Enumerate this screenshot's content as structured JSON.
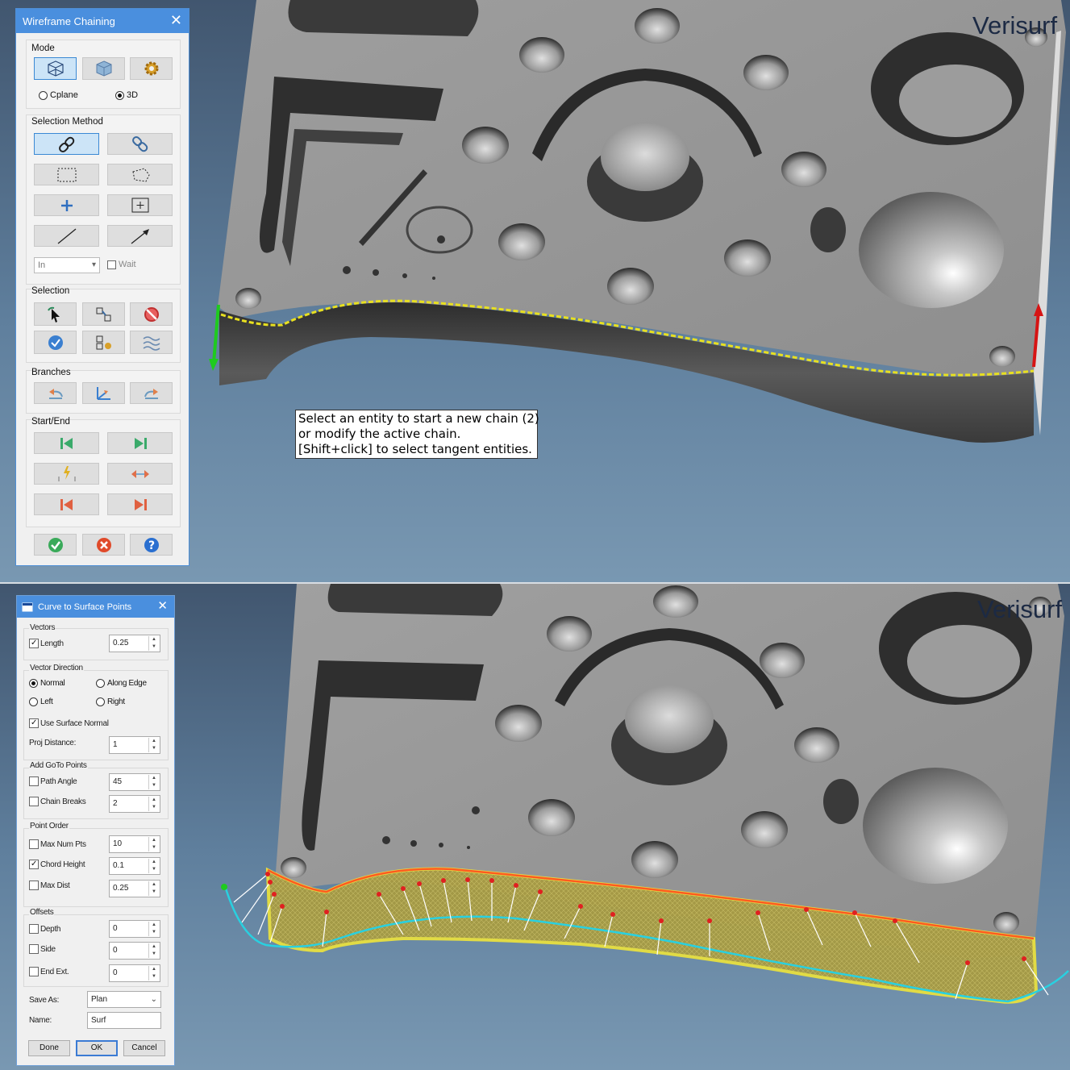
{
  "brand": "Verisurf",
  "top_panel": {
    "dialog": {
      "title": "Wireframe Chaining",
      "mode": {
        "label": "Mode",
        "buttons": [
          "wireframe-cube-icon",
          "solid-cube-icon",
          "gear-icon"
        ],
        "radio_cplane": "Cplane",
        "radio_3d": "3D",
        "selected": "3D"
      },
      "selection_method": {
        "label": "Selection Method",
        "buttons": [
          "chain-icon",
          "partial-chain-icon",
          "window-icon",
          "polygon-icon",
          "single-point-icon",
          "area-icon",
          "vector-line-icon",
          "vector-arrow-icon"
        ],
        "combo_value": "In",
        "wait_label": "Wait"
      },
      "selection": {
        "label": "Selection",
        "buttons": [
          "select-arrow-icon",
          "last-chain-icon",
          "unselect-icon",
          "select-all-icon",
          "chain-options-icon",
          "similar-icon"
        ]
      },
      "branches": {
        "label": "Branches",
        "buttons": [
          "branch-back-icon",
          "branch-axis-icon",
          "branch-forward-icon"
        ]
      },
      "start_end": {
        "label": "Start/End",
        "buttons": [
          "start-first-icon",
          "end-last-icon",
          "dynamic-icon",
          "reverse-icon",
          "move-start-icon",
          "move-end-icon"
        ]
      },
      "footer": [
        "ok-check-icon",
        "cancel-x-icon",
        "help-icon"
      ]
    },
    "tooltip": [
      "Select an entity to start a new chain (2)",
      "or modify the active chain.",
      "[Shift+click] to select tangent entities."
    ]
  },
  "bottom_panel": {
    "dialog": {
      "title": "Curve to Surface Points",
      "vectors": {
        "label": "Vectors",
        "length_label": "Length",
        "length_checked": true,
        "length_value": "0.25"
      },
      "vector_direction": {
        "label": "Vector Direction",
        "normal": "Normal",
        "along_edge": "Along Edge",
        "left": "Left",
        "right": "Right",
        "selected": "Normal",
        "use_surface_normal": "Use Surface Normal",
        "use_surface_normal_checked": true,
        "proj_distance_label": "Proj Distance:",
        "proj_distance_value": "1"
      },
      "add_goto": {
        "label": "Add GoTo Points",
        "path_angle_label": "Path Angle",
        "path_angle_value": "45",
        "chain_breaks_label": "Chain Breaks",
        "chain_breaks_value": "2"
      },
      "point_order": {
        "label": "Point Order",
        "max_num_pts_label": "Max Num Pts",
        "max_num_pts_value": "10",
        "chord_height_label": "Chord Height",
        "chord_height_value": "0.1",
        "chord_height_checked": true,
        "max_dist_label": "Max Dist",
        "max_dist_value": "0.25"
      },
      "offsets": {
        "label": "Offsets",
        "depth_label": "Depth",
        "depth_value": "0",
        "side_label": "Side",
        "side_value": "0",
        "end_ext_label": "End Ext.",
        "end_ext_value": "0"
      },
      "save_as_label": "Save As:",
      "save_as_value": "Plan",
      "name_label": "Name:",
      "name_value": "Surf",
      "buttons": {
        "done": "Done",
        "ok": "OK",
        "cancel": "Cancel"
      }
    }
  }
}
